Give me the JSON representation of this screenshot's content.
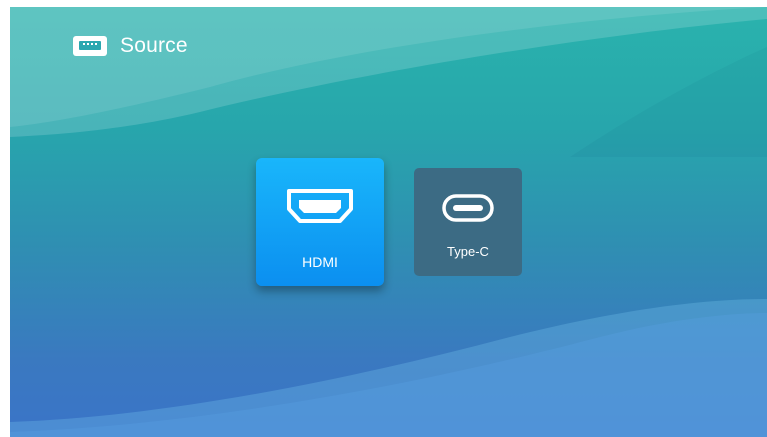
{
  "header": {
    "icon": "hdmi-port-icon",
    "title": "Source"
  },
  "sources": [
    {
      "label": "HDMI",
      "icon": "hdmi-connector-icon",
      "selected": true
    },
    {
      "label": "Type-C",
      "icon": "usb-c-connector-icon",
      "selected": false
    }
  ],
  "colors": {
    "background_top": "#2ab3ad",
    "background_bottom": "#3a74c8",
    "selected_tile": "#0b9df5",
    "unselected_tile": "#3c6b84",
    "text": "#ffffff"
  }
}
